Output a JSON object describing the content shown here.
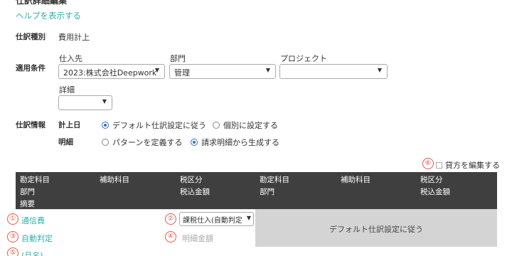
{
  "top_cut_title": "仕訳詳細編集",
  "help_link": "ヘルプを表示する",
  "journal_type": {
    "label": "仕訳種別",
    "value": "費用計上"
  },
  "conditions": {
    "label": "適用条件",
    "supplier": {
      "label": "仕入先",
      "value": "2023:株式会社Deepwork"
    },
    "department": {
      "label": "部門",
      "value": "管理"
    },
    "project": {
      "label": "プロジェクト",
      "value": ""
    },
    "detail": {
      "label": "詳細",
      "value": ""
    }
  },
  "journal_info": {
    "label": "仕訳情報",
    "recording_date": {
      "label": "計上日",
      "options": [
        "デフォルト仕訳設定に従う",
        "個別に設定する"
      ],
      "selected": 0
    },
    "line_items": {
      "label": "明細",
      "options": [
        "パターンを定義する",
        "請求明細から生成する"
      ],
      "selected": 1
    }
  },
  "edit_debit": {
    "marker": "⑥",
    "label": "貸方を編集する",
    "checked": false
  },
  "table_header": {
    "col1_line1": "勘定科目",
    "col1_line2": "部門",
    "col1_line3": "摘要",
    "col2_line1": "補助科目",
    "col3_line1": "税区分",
    "col3_line2": "税込金額",
    "col4_line1": "勘定科目",
    "col4_line2": "部門",
    "col5_line1": "補助科目",
    "col6_line1": "税区分",
    "col6_line2": "税込金額"
  },
  "row": {
    "account": {
      "marker": "①",
      "value": "通信費"
    },
    "tax": {
      "marker": "②",
      "value": "課税仕入(自動判定"
    },
    "department": {
      "marker": "③",
      "value": "自動判定"
    },
    "amount": {
      "marker": "④",
      "placeholder": "明細金額"
    },
    "summary": {
      "marker": "⑤",
      "value": "(月名)"
    },
    "credit_default": "デフォルト仕訳設定に従う"
  },
  "colors": {
    "accent": "#2bb3a8",
    "header_bg": "#3f3f3f",
    "marker": "#e8584b",
    "radio": "#2f6fd6"
  }
}
